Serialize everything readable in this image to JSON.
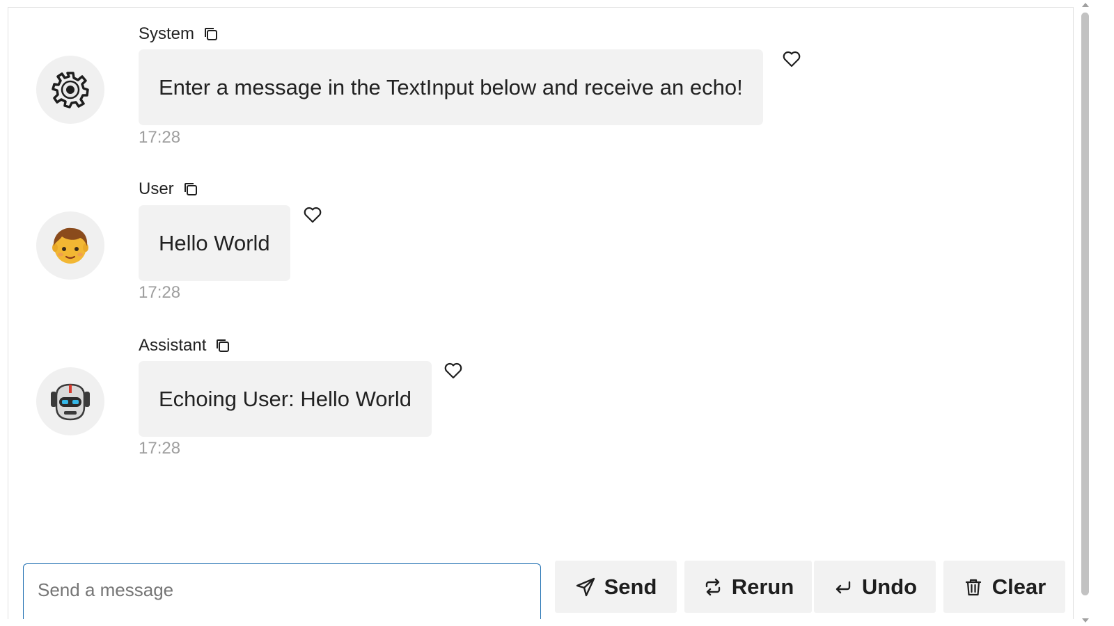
{
  "messages": [
    {
      "role": "System",
      "avatar_icon": "gear-icon",
      "text": "Enter a message in the TextInput below and receive an echo!",
      "time": "17:28"
    },
    {
      "role": "User",
      "avatar_icon": "boy-emoji-icon",
      "text": "Hello World",
      "time": "17:28"
    },
    {
      "role": "Assistant",
      "avatar_icon": "robot-emoji-icon",
      "text": "Echoing User: Hello World",
      "time": "17:28"
    }
  ],
  "input": {
    "placeholder": "Send a message"
  },
  "buttons": {
    "send": "Send",
    "rerun": "Rerun",
    "undo": "Undo",
    "clear": "Clear"
  },
  "colors": {
    "bubble": "#f2f2f2",
    "avatar_bg": "#f0f0f0",
    "timestamp": "#9e9e9e",
    "input_border": "#1f6fb2"
  }
}
